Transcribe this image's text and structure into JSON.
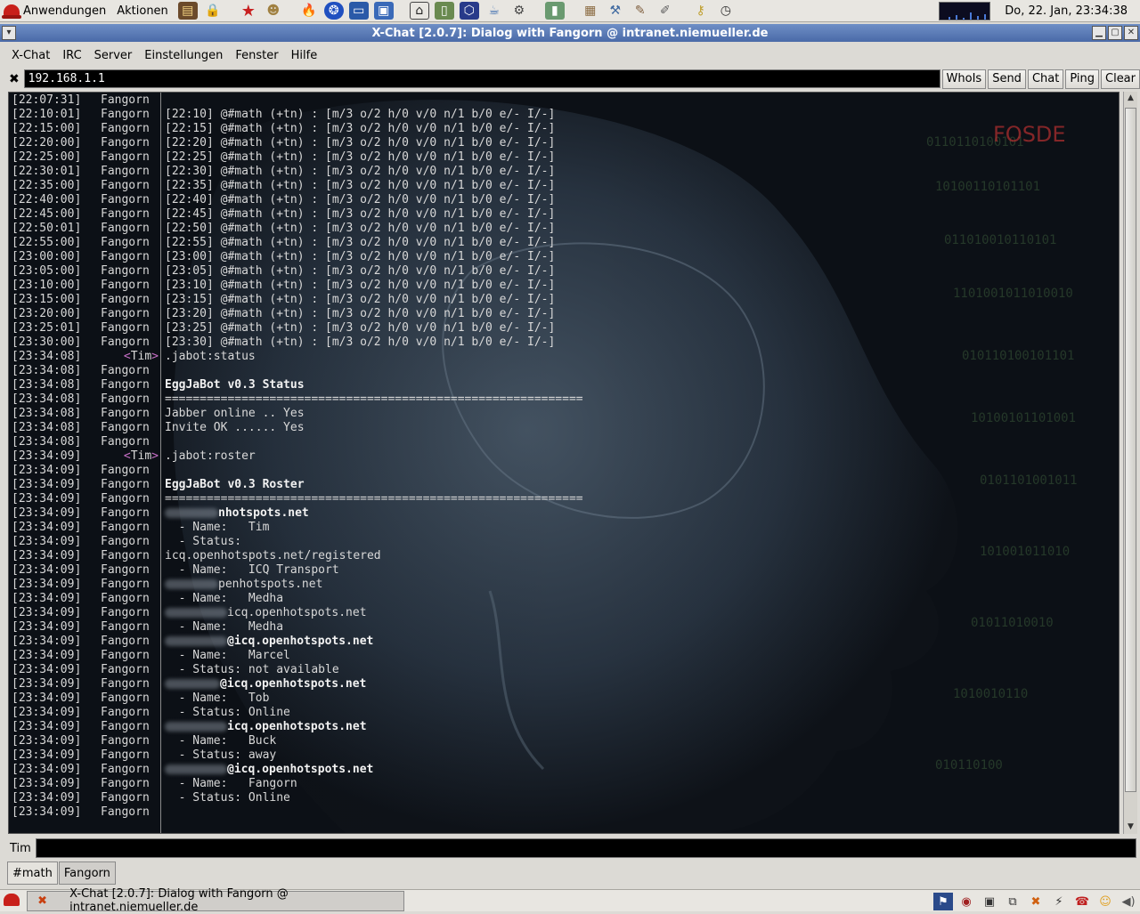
{
  "top_panel": {
    "menu_apps": "Anwendungen",
    "menu_actions": "Aktionen",
    "launchers": [
      "notes-icon",
      "lock-icon",
      "star-icon",
      "update-icon",
      "firefox-icon",
      "mozilla-icon",
      "terminal-icon",
      "image-viewer-icon",
      "inkscape-icon",
      "device-icon",
      "3d-icon",
      "java-icon",
      "system-monitor-icon",
      "pda-icon",
      "folder-icon",
      "network-icon",
      "gimp-icon",
      "pen-icon",
      "keys-icon",
      "clock-icon"
    ],
    "clock": "Do, 22. Jan, 23:34:38"
  },
  "window": {
    "title": "X-Chat [2.0.7]: Dialog with Fangorn @ intranet.niemueller.de"
  },
  "menubar": {
    "items": [
      "X-Chat",
      "IRC",
      "Server",
      "Einstellungen",
      "Fenster",
      "Hilfe"
    ]
  },
  "topic": {
    "value": "192.168.1.1",
    "buttons": [
      "WhoIs",
      "Send",
      "Chat",
      "Ping",
      "Clear"
    ]
  },
  "chat": {
    "lines": [
      {
        "ts": "[22:07:31]",
        "nick": "Fangorn",
        "msg": ""
      },
      {
        "ts": "[22:10:01]",
        "nick": "Fangorn",
        "msg": "[22:10] @#math (+tn) : [m/3 o/2 h/0 v/0 n/1 b/0 e/- I/-]"
      },
      {
        "ts": "[22:15:00]",
        "nick": "Fangorn",
        "msg": "[22:15] @#math (+tn) : [m/3 o/2 h/0 v/0 n/1 b/0 e/- I/-]"
      },
      {
        "ts": "[22:20:00]",
        "nick": "Fangorn",
        "msg": "[22:20] @#math (+tn) : [m/3 o/2 h/0 v/0 n/1 b/0 e/- I/-]"
      },
      {
        "ts": "[22:25:00]",
        "nick": "Fangorn",
        "msg": "[22:25] @#math (+tn) : [m/3 o/2 h/0 v/0 n/1 b/0 e/- I/-]"
      },
      {
        "ts": "[22:30:01]",
        "nick": "Fangorn",
        "msg": "[22:30] @#math (+tn) : [m/3 o/2 h/0 v/0 n/1 b/0 e/- I/-]"
      },
      {
        "ts": "[22:35:00]",
        "nick": "Fangorn",
        "msg": "[22:35] @#math (+tn) : [m/3 o/2 h/0 v/0 n/1 b/0 e/- I/-]"
      },
      {
        "ts": "[22:40:00]",
        "nick": "Fangorn",
        "msg": "[22:40] @#math (+tn) : [m/3 o/2 h/0 v/0 n/1 b/0 e/- I/-]"
      },
      {
        "ts": "[22:45:00]",
        "nick": "Fangorn",
        "msg": "[22:45] @#math (+tn) : [m/3 o/2 h/0 v/0 n/1 b/0 e/- I/-]"
      },
      {
        "ts": "[22:50:01]",
        "nick": "Fangorn",
        "msg": "[22:50] @#math (+tn) : [m/3 o/2 h/0 v/0 n/1 b/0 e/- I/-]"
      },
      {
        "ts": "[22:55:00]",
        "nick": "Fangorn",
        "msg": "[22:55] @#math (+tn) : [m/3 o/2 h/0 v/0 n/1 b/0 e/- I/-]"
      },
      {
        "ts": "[23:00:00]",
        "nick": "Fangorn",
        "msg": "[23:00] @#math (+tn) : [m/3 o/2 h/0 v/0 n/1 b/0 e/- I/-]"
      },
      {
        "ts": "[23:05:00]",
        "nick": "Fangorn",
        "msg": "[23:05] @#math (+tn) : [m/3 o/2 h/0 v/0 n/1 b/0 e/- I/-]"
      },
      {
        "ts": "[23:10:00]",
        "nick": "Fangorn",
        "msg": "[23:10] @#math (+tn) : [m/3 o/2 h/0 v/0 n/1 b/0 e/- I/-]"
      },
      {
        "ts": "[23:15:00]",
        "nick": "Fangorn",
        "msg": "[23:15] @#math (+tn) : [m/3 o/2 h/0 v/0 n/1 b/0 e/- I/-]"
      },
      {
        "ts": "[23:20:00]",
        "nick": "Fangorn",
        "msg": "[23:20] @#math (+tn) : [m/3 o/2 h/0 v/0 n/1 b/0 e/- I/-]"
      },
      {
        "ts": "[23:25:01]",
        "nick": "Fangorn",
        "msg": "[23:25] @#math (+tn) : [m/3 o/2 h/0 v/0 n/1 b/0 e/- I/-]"
      },
      {
        "ts": "[23:30:00]",
        "nick": "Fangorn",
        "msg": "[23:30] @#math (+tn) : [m/3 o/2 h/0 v/0 n/1 b/0 e/- I/-]"
      },
      {
        "ts": "[23:34:08]",
        "nick": "Tim",
        "self": true,
        "msg": ".jabot:status"
      },
      {
        "ts": "[23:34:08]",
        "nick": "Fangorn",
        "msg": ""
      },
      {
        "ts": "[23:34:08]",
        "nick": "Fangorn",
        "msg": "EggJaBot v0.3 Status",
        "bold": true
      },
      {
        "ts": "[23:34:08]",
        "nick": "Fangorn",
        "msg": "============================================================"
      },
      {
        "ts": "[23:34:08]",
        "nick": "Fangorn",
        "msg": "Jabber online .. Yes"
      },
      {
        "ts": "[23:34:08]",
        "nick": "Fangorn",
        "msg": "Invite OK ...... Yes"
      },
      {
        "ts": "[23:34:08]",
        "nick": "Fangorn",
        "msg": ""
      },
      {
        "ts": "[23:34:09]",
        "nick": "Tim",
        "self": true,
        "msg": ".jabot:roster"
      },
      {
        "ts": "[23:34:09]",
        "nick": "Fangorn",
        "msg": ""
      },
      {
        "ts": "[23:34:09]",
        "nick": "Fangorn",
        "msg": "EggJaBot v0.3 Roster",
        "bold": true
      },
      {
        "ts": "[23:34:09]",
        "nick": "Fangorn",
        "msg": "============================================================"
      },
      {
        "ts": "[23:34:09]",
        "nick": "Fangorn",
        "msg": "nhotspots.net",
        "bold": true,
        "blur": 60
      },
      {
        "ts": "[23:34:09]",
        "nick": "Fangorn",
        "msg": "  - Name:   Tim"
      },
      {
        "ts": "[23:34:09]",
        "nick": "Fangorn",
        "msg": "  - Status:"
      },
      {
        "ts": "[23:34:09]",
        "nick": "Fangorn",
        "msg": "icq.openhotspots.net/registered"
      },
      {
        "ts": "[23:34:09]",
        "nick": "Fangorn",
        "msg": "  - Name:   ICQ Transport"
      },
      {
        "ts": "[23:34:09]",
        "nick": "Fangorn",
        "msg": "penhotspots.net",
        "blur": 60
      },
      {
        "ts": "[23:34:09]",
        "nick": "Fangorn",
        "msg": "  - Name:   Medha"
      },
      {
        "ts": "[23:34:09]",
        "nick": "Fangorn",
        "msg": "icq.openhotspots.net",
        "blur": 70
      },
      {
        "ts": "[23:34:09]",
        "nick": "Fangorn",
        "msg": "  - Name:   Medha"
      },
      {
        "ts": "[23:34:09]",
        "nick": "Fangorn",
        "msg": "@icq.openhotspots.net",
        "bold": true,
        "blur": 70
      },
      {
        "ts": "[23:34:09]",
        "nick": "Fangorn",
        "msg": "  - Name:   Marcel"
      },
      {
        "ts": "[23:34:09]",
        "nick": "Fangorn",
        "msg": "  - Status: not available"
      },
      {
        "ts": "[23:34:09]",
        "nick": "Fangorn",
        "msg": "@icq.openhotspots.net",
        "bold": true,
        "blur": 62
      },
      {
        "ts": "[23:34:09]",
        "nick": "Fangorn",
        "msg": "  - Name:   Tob"
      },
      {
        "ts": "[23:34:09]",
        "nick": "Fangorn",
        "msg": "  - Status: Online"
      },
      {
        "ts": "[23:34:09]",
        "nick": "Fangorn",
        "msg": "icq.openhotspots.net",
        "bold": true,
        "blur": 70
      },
      {
        "ts": "[23:34:09]",
        "nick": "Fangorn",
        "msg": "  - Name:   Buck"
      },
      {
        "ts": "[23:34:09]",
        "nick": "Fangorn",
        "msg": "  - Status: away"
      },
      {
        "ts": "[23:34:09]",
        "nick": "Fangorn",
        "msg": "@icq.openhotspots.net",
        "bold": true,
        "blur": 70
      },
      {
        "ts": "[23:34:09]",
        "nick": "Fangorn",
        "msg": "  - Name:   Fangorn"
      },
      {
        "ts": "[23:34:09]",
        "nick": "Fangorn",
        "msg": "  - Status: Online"
      },
      {
        "ts": "[23:34:09]",
        "nick": "Fangorn",
        "msg": ""
      }
    ],
    "watermark": "FOSDE"
  },
  "input": {
    "nick": "Tim",
    "value": ""
  },
  "tabs": [
    "#math",
    "Fangorn"
  ],
  "bottom_panel": {
    "task_title": "X-Chat [2.0.7]: Dialog with Fangorn @ intranet.niemueller.de",
    "tray": [
      "network-icon",
      "eye-icon",
      "monitor-icon",
      "display-icon",
      "xchat-icon",
      "network-status-icon",
      "phone-icon",
      "user-icon",
      "volume-icon"
    ]
  },
  "colors": {
    "titlebar": "#4a6aa8",
    "chat_bg": "#0b0f14",
    "chat_text": "#d8d8d8",
    "nick_bracket": "#c870c8"
  }
}
